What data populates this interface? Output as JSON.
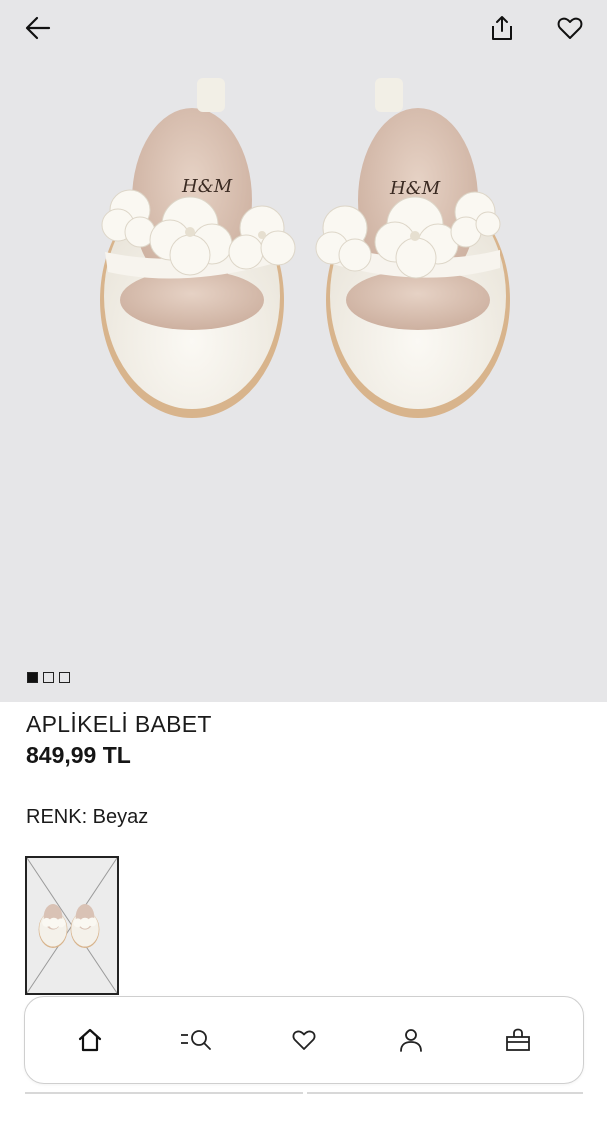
{
  "product": {
    "name": "APLİKELİ BABET",
    "price": "849,99 TL",
    "color_label": "RENK: Beyaz",
    "insole_brand": "H&M"
  },
  "gallery": {
    "image_count": 3,
    "active_index": 0
  },
  "icons": {
    "back": "arrow-left-icon",
    "share": "share-icon",
    "favorite": "heart-icon"
  },
  "bottom_nav": {
    "items": [
      {
        "name": "home",
        "icon": "home-icon",
        "active": true
      },
      {
        "name": "search",
        "icon": "search-icon",
        "active": false
      },
      {
        "name": "favorites",
        "icon": "heart-icon",
        "active": false
      },
      {
        "name": "account",
        "icon": "user-icon",
        "active": false
      },
      {
        "name": "bag",
        "icon": "shopping-bag-icon",
        "active": false
      }
    ]
  },
  "colors": {
    "hero_background": "#e6e6e8",
    "text": "#1a1a1a",
    "shoe_white": "#f4f1ea",
    "insole": "#d9c2b5",
    "sole": "#d8b48c"
  }
}
